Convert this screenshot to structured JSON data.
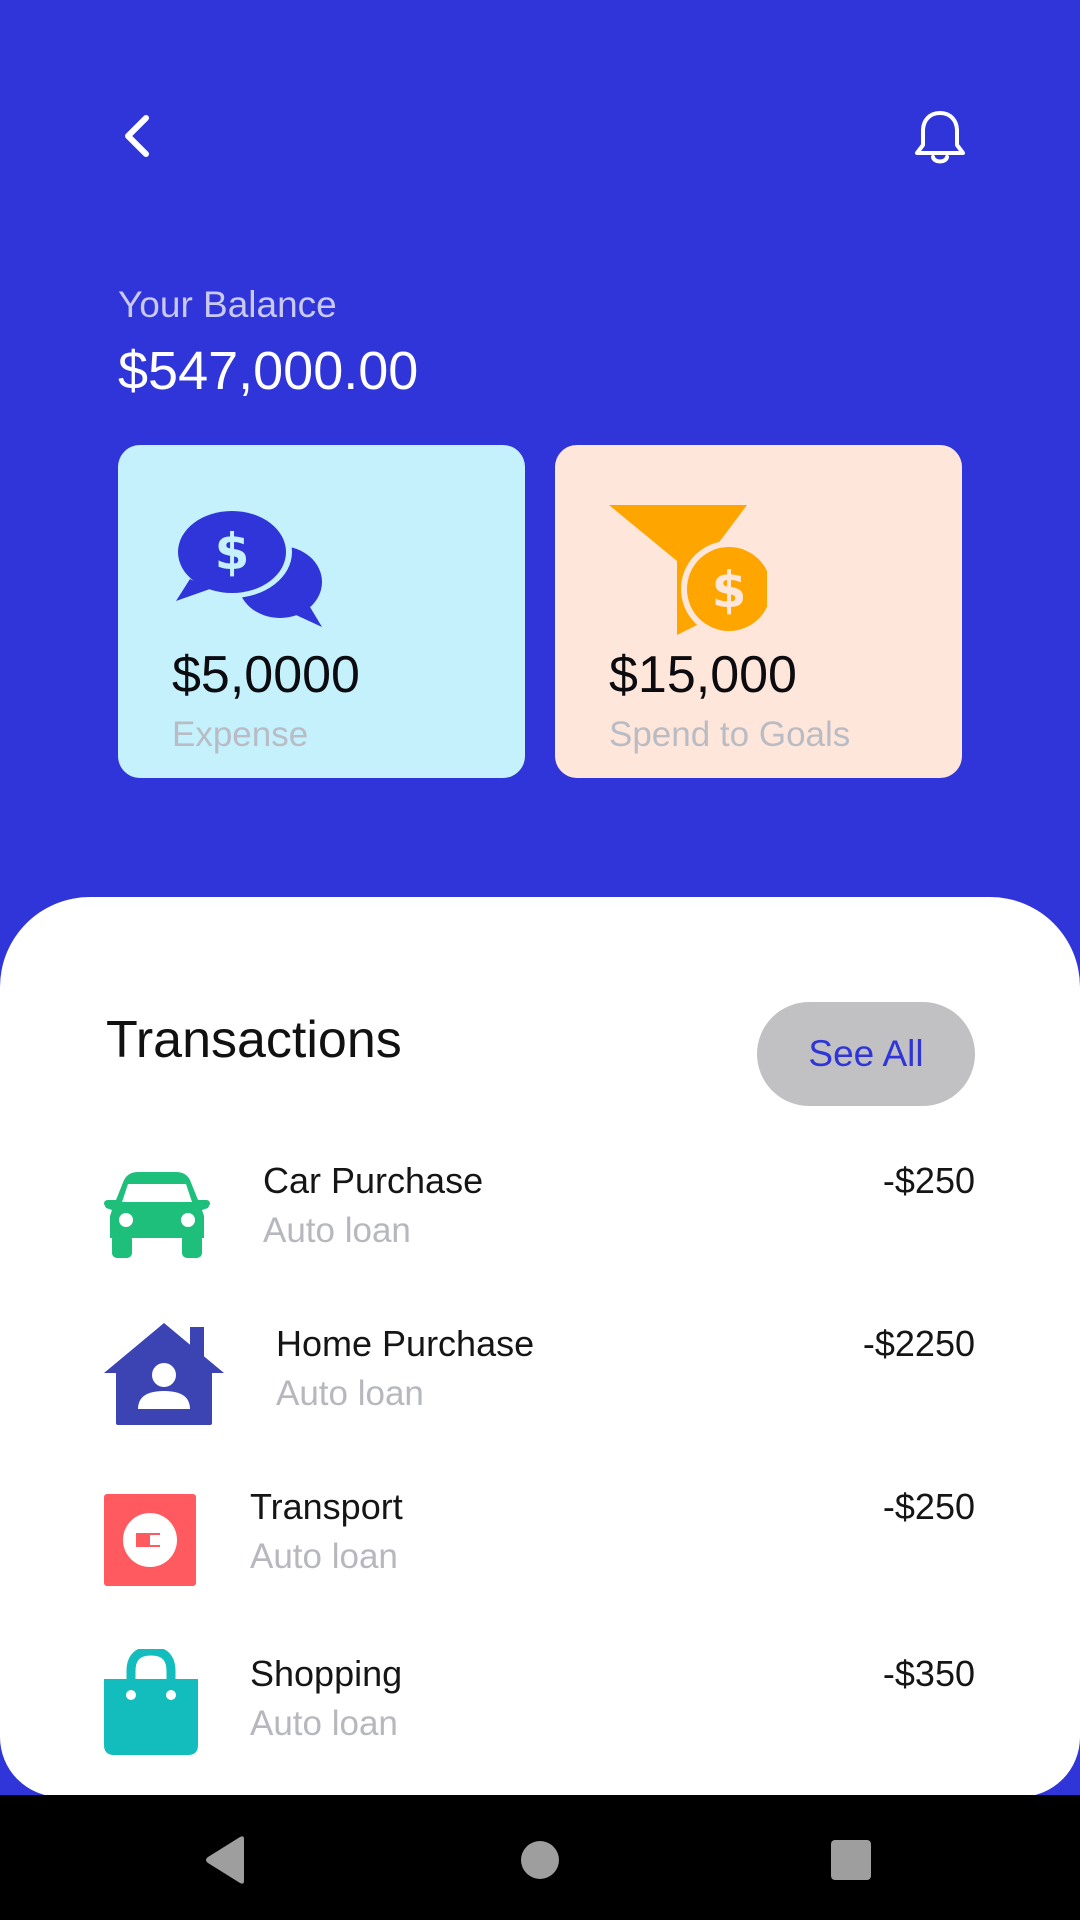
{
  "header": {
    "balance_label": "Your Balance",
    "balance_value": "$547,000.00"
  },
  "cards": [
    {
      "amount": "$5,0000",
      "label": "Expense",
      "icon": "dollar-chat-icon",
      "bg": "#C4F1FB"
    },
    {
      "amount": "$15,000",
      "label": "Spend to Goals",
      "icon": "funnel-dollar-icon",
      "bg": "#FFE6DA"
    }
  ],
  "transactions": {
    "title": "Transactions",
    "see_all_label": "See All",
    "items": [
      {
        "title": "Car Purchase",
        "subtitle": "Auto loan",
        "amount": "-$250",
        "icon": "car-icon",
        "color": "#1EBF7A"
      },
      {
        "title": "Home Purchase",
        "subtitle": "Auto loan",
        "amount": "-$2250",
        "icon": "house-icon",
        "color": "#3C44B4"
      },
      {
        "title": "Transport",
        "subtitle": "Auto loan",
        "amount": "-$250",
        "icon": "uber-icon",
        "color": "#FF5A5F"
      },
      {
        "title": "Shopping",
        "subtitle": "Auto loan",
        "amount": "-$350",
        "icon": "shopping-bag-icon",
        "color": "#14BDBD"
      }
    ]
  },
  "colors": {
    "primary": "#2F35D8",
    "accent_orange": "#FFA500",
    "background_sheet": "#FFFFFF"
  }
}
